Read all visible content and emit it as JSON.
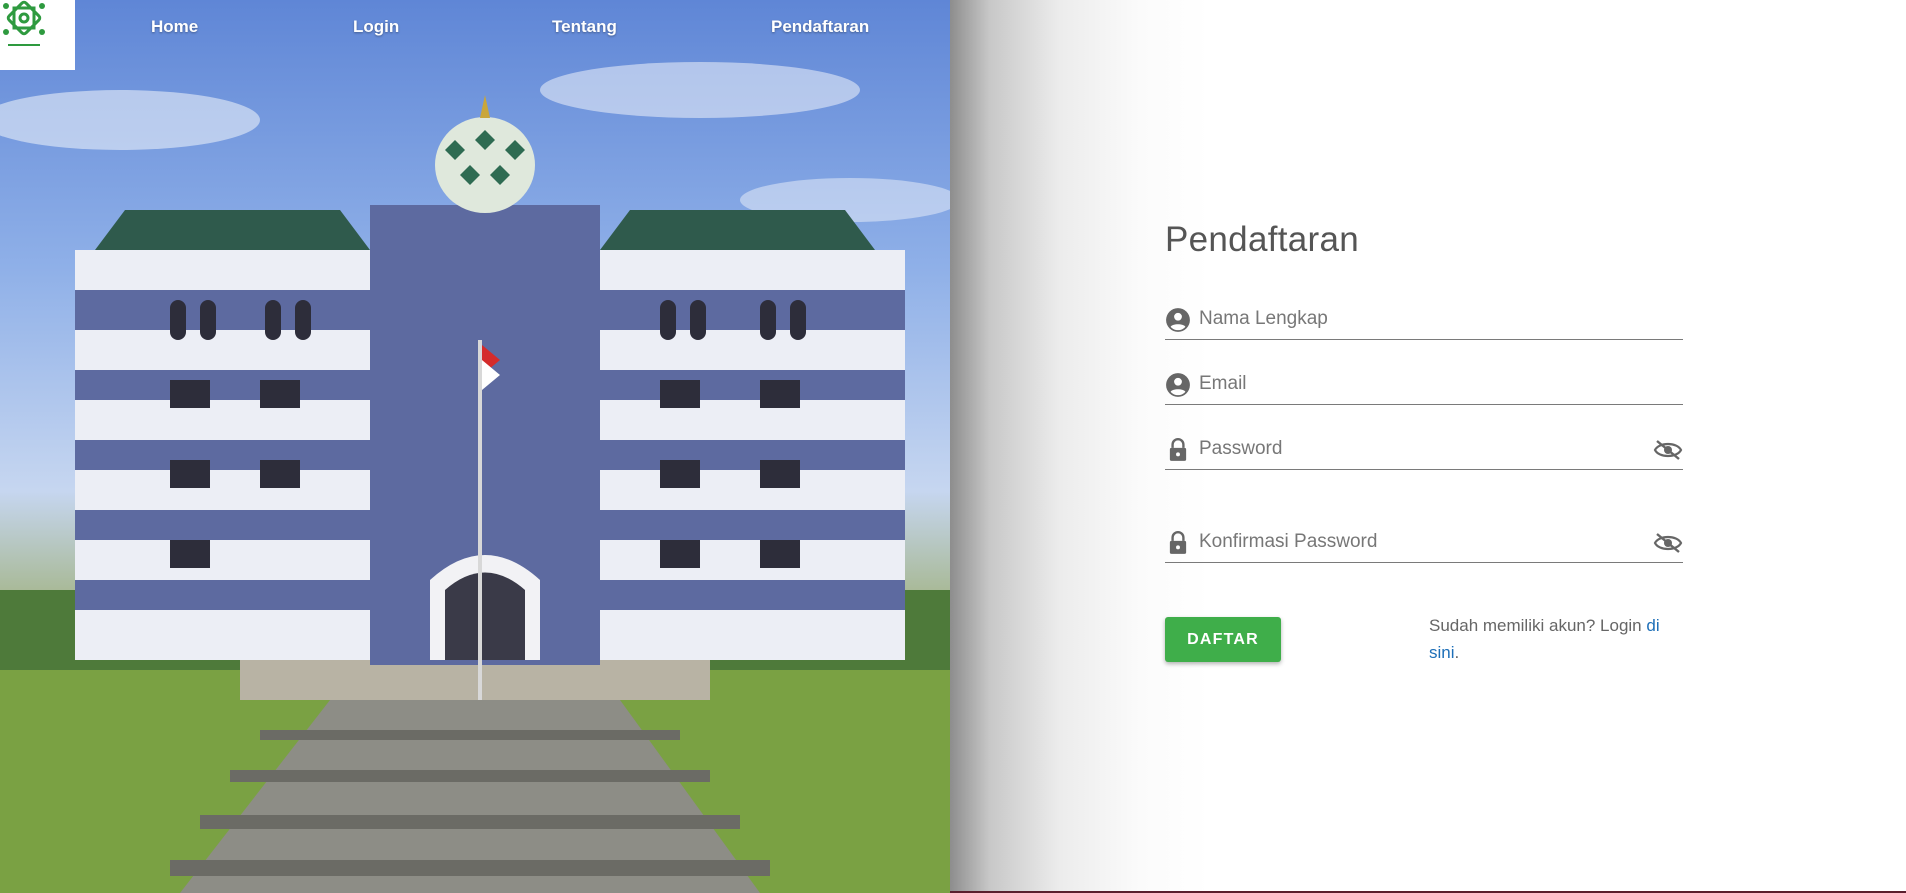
{
  "nav": {
    "items": [
      {
        "label": "Home"
      },
      {
        "label": "Login"
      },
      {
        "label": "Tentang"
      },
      {
        "label": "Pendaftaran"
      }
    ]
  },
  "form": {
    "title": "Pendaftaran",
    "fields": [
      {
        "placeholder": "Nama Lengkap",
        "icon": "account-circle-icon",
        "value": ""
      },
      {
        "placeholder": "Email",
        "icon": "account-circle-icon",
        "value": ""
      },
      {
        "placeholder": "Password",
        "icon": "lock-icon",
        "value": "",
        "toggle_icon": "eye-off-icon"
      },
      {
        "placeholder": "Konfirmasi Password",
        "icon": "lock-icon",
        "value": "",
        "toggle_icon": "eye-off-icon"
      }
    ],
    "submit_label": "DAFTAR",
    "login_hint": {
      "text": "Sudah memiliki akun? Login ",
      "link_text": "di sini",
      "suffix": "."
    }
  },
  "colors": {
    "accent_green": "#3fae4a",
    "link_blue": "#1d6fb8",
    "logo_green": "#2e9a3f"
  }
}
